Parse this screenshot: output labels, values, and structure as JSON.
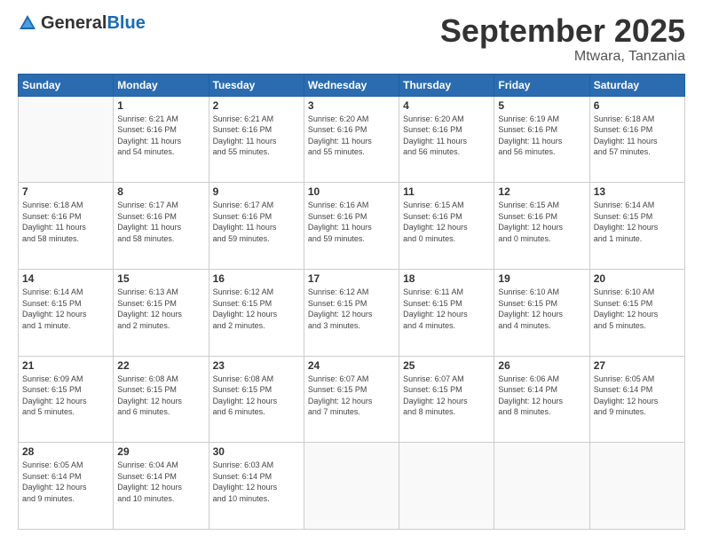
{
  "header": {
    "logo_general": "General",
    "logo_blue": "Blue",
    "month": "September 2025",
    "location": "Mtwara, Tanzania"
  },
  "days_of_week": [
    "Sunday",
    "Monday",
    "Tuesday",
    "Wednesday",
    "Thursday",
    "Friday",
    "Saturday"
  ],
  "weeks": [
    [
      {
        "day": "",
        "info": ""
      },
      {
        "day": "1",
        "info": "Sunrise: 6:21 AM\nSunset: 6:16 PM\nDaylight: 11 hours\nand 54 minutes."
      },
      {
        "day": "2",
        "info": "Sunrise: 6:21 AM\nSunset: 6:16 PM\nDaylight: 11 hours\nand 55 minutes."
      },
      {
        "day": "3",
        "info": "Sunrise: 6:20 AM\nSunset: 6:16 PM\nDaylight: 11 hours\nand 55 minutes."
      },
      {
        "day": "4",
        "info": "Sunrise: 6:20 AM\nSunset: 6:16 PM\nDaylight: 11 hours\nand 56 minutes."
      },
      {
        "day": "5",
        "info": "Sunrise: 6:19 AM\nSunset: 6:16 PM\nDaylight: 11 hours\nand 56 minutes."
      },
      {
        "day": "6",
        "info": "Sunrise: 6:18 AM\nSunset: 6:16 PM\nDaylight: 11 hours\nand 57 minutes."
      }
    ],
    [
      {
        "day": "7",
        "info": "Sunrise: 6:18 AM\nSunset: 6:16 PM\nDaylight: 11 hours\nand 58 minutes."
      },
      {
        "day": "8",
        "info": "Sunrise: 6:17 AM\nSunset: 6:16 PM\nDaylight: 11 hours\nand 58 minutes."
      },
      {
        "day": "9",
        "info": "Sunrise: 6:17 AM\nSunset: 6:16 PM\nDaylight: 11 hours\nand 59 minutes."
      },
      {
        "day": "10",
        "info": "Sunrise: 6:16 AM\nSunset: 6:16 PM\nDaylight: 11 hours\nand 59 minutes."
      },
      {
        "day": "11",
        "info": "Sunrise: 6:15 AM\nSunset: 6:16 PM\nDaylight: 12 hours\nand 0 minutes."
      },
      {
        "day": "12",
        "info": "Sunrise: 6:15 AM\nSunset: 6:16 PM\nDaylight: 12 hours\nand 0 minutes."
      },
      {
        "day": "13",
        "info": "Sunrise: 6:14 AM\nSunset: 6:15 PM\nDaylight: 12 hours\nand 1 minute."
      }
    ],
    [
      {
        "day": "14",
        "info": "Sunrise: 6:14 AM\nSunset: 6:15 PM\nDaylight: 12 hours\nand 1 minute."
      },
      {
        "day": "15",
        "info": "Sunrise: 6:13 AM\nSunset: 6:15 PM\nDaylight: 12 hours\nand 2 minutes."
      },
      {
        "day": "16",
        "info": "Sunrise: 6:12 AM\nSunset: 6:15 PM\nDaylight: 12 hours\nand 2 minutes."
      },
      {
        "day": "17",
        "info": "Sunrise: 6:12 AM\nSunset: 6:15 PM\nDaylight: 12 hours\nand 3 minutes."
      },
      {
        "day": "18",
        "info": "Sunrise: 6:11 AM\nSunset: 6:15 PM\nDaylight: 12 hours\nand 4 minutes."
      },
      {
        "day": "19",
        "info": "Sunrise: 6:10 AM\nSunset: 6:15 PM\nDaylight: 12 hours\nand 4 minutes."
      },
      {
        "day": "20",
        "info": "Sunrise: 6:10 AM\nSunset: 6:15 PM\nDaylight: 12 hours\nand 5 minutes."
      }
    ],
    [
      {
        "day": "21",
        "info": "Sunrise: 6:09 AM\nSunset: 6:15 PM\nDaylight: 12 hours\nand 5 minutes."
      },
      {
        "day": "22",
        "info": "Sunrise: 6:08 AM\nSunset: 6:15 PM\nDaylight: 12 hours\nand 6 minutes."
      },
      {
        "day": "23",
        "info": "Sunrise: 6:08 AM\nSunset: 6:15 PM\nDaylight: 12 hours\nand 6 minutes."
      },
      {
        "day": "24",
        "info": "Sunrise: 6:07 AM\nSunset: 6:15 PM\nDaylight: 12 hours\nand 7 minutes."
      },
      {
        "day": "25",
        "info": "Sunrise: 6:07 AM\nSunset: 6:15 PM\nDaylight: 12 hours\nand 8 minutes."
      },
      {
        "day": "26",
        "info": "Sunrise: 6:06 AM\nSunset: 6:14 PM\nDaylight: 12 hours\nand 8 minutes."
      },
      {
        "day": "27",
        "info": "Sunrise: 6:05 AM\nSunset: 6:14 PM\nDaylight: 12 hours\nand 9 minutes."
      }
    ],
    [
      {
        "day": "28",
        "info": "Sunrise: 6:05 AM\nSunset: 6:14 PM\nDaylight: 12 hours\nand 9 minutes."
      },
      {
        "day": "29",
        "info": "Sunrise: 6:04 AM\nSunset: 6:14 PM\nDaylight: 12 hours\nand 10 minutes."
      },
      {
        "day": "30",
        "info": "Sunrise: 6:03 AM\nSunset: 6:14 PM\nDaylight: 12 hours\nand 10 minutes."
      },
      {
        "day": "",
        "info": ""
      },
      {
        "day": "",
        "info": ""
      },
      {
        "day": "",
        "info": ""
      },
      {
        "day": "",
        "info": ""
      }
    ]
  ]
}
